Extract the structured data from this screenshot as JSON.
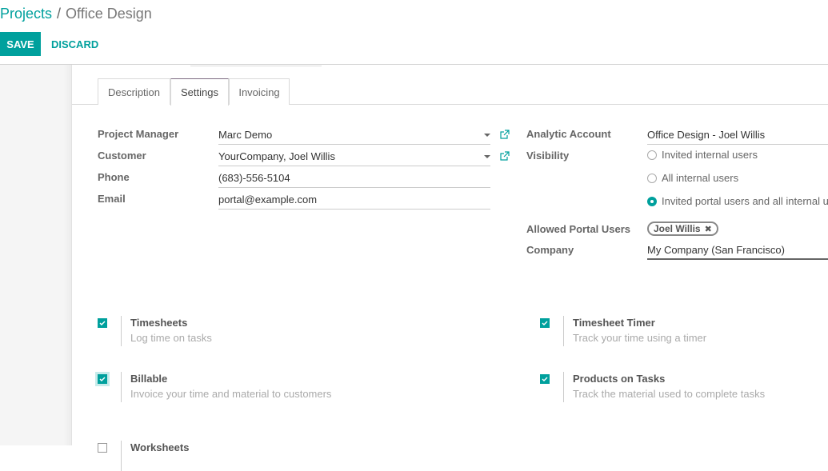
{
  "breadcrumb": {
    "parent": "Projects",
    "separator": "/",
    "current": "Office Design"
  },
  "toolbar": {
    "save_label": "SAVE",
    "discard_label": "DISCARD"
  },
  "tabs": [
    {
      "label": "Description",
      "active": false
    },
    {
      "label": "Settings",
      "active": true
    },
    {
      "label": "Invoicing",
      "active": false
    }
  ],
  "left_fields": {
    "project_manager": {
      "label": "Project Manager",
      "value": "Marc Demo"
    },
    "customer": {
      "label": "Customer",
      "value": "YourCompany, Joel Willis"
    },
    "phone": {
      "label": "Phone",
      "value": "(683)-556-5104"
    },
    "email": {
      "label": "Email",
      "value": "portal@example.com"
    }
  },
  "right_fields": {
    "analytic_account": {
      "label": "Analytic Account",
      "value": "Office Design - Joel Willis"
    },
    "visibility": {
      "label": "Visibility",
      "options": [
        {
          "label": "Invited internal users",
          "selected": false
        },
        {
          "label": "All internal users",
          "selected": false
        },
        {
          "label": "Invited portal users and all internal users",
          "selected": true
        }
      ]
    },
    "allowed_portal_users": {
      "label": "Allowed Portal Users",
      "tags": [
        "Joel Willis"
      ]
    },
    "company": {
      "label": "Company",
      "value": "My Company (San Francisco)"
    }
  },
  "settings": [
    {
      "title": "Timesheets",
      "description": "Log time on tasks",
      "checked": true
    },
    {
      "title": "Timesheet Timer",
      "description": "Track your time using a timer",
      "checked": true
    },
    {
      "title": "Billable",
      "description": "Invoice your time and material to customers",
      "checked": true
    },
    {
      "title": "Products on Tasks",
      "description": "Track the material used to complete tasks",
      "checked": true
    },
    {
      "title": "Worksheets",
      "description": "",
      "checked": false
    }
  ],
  "colors": {
    "accent": "#00a09d",
    "tab_active_border": "#7c6a81"
  }
}
